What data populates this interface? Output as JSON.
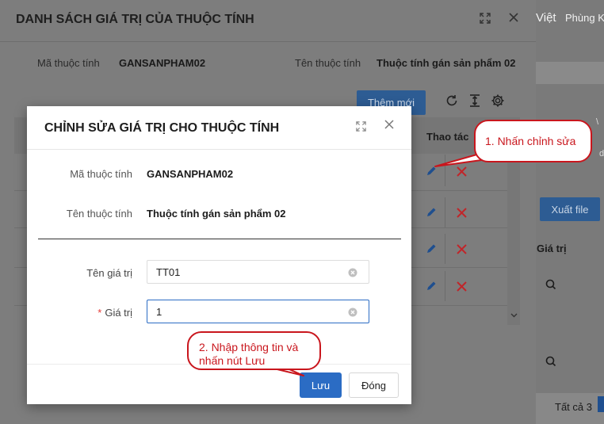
{
  "background": {
    "language": "Việt",
    "user": "Phùng K",
    "export_label": "Xuất file",
    "column_value": "Giá trị",
    "total_label": "Tất cả 3",
    "fragment_a": "\\",
    "fragment_b": "ding"
  },
  "list_dialog": {
    "title": "DANH SÁCH GIÁ TRỊ CỦA THUỘC TÍNH",
    "attr_code_label": "Mã thuộc tính",
    "attr_code_value": "GANSANPHAM02",
    "attr_name_label": "Tên thuộc tính",
    "attr_name_value": "Thuộc tính gán sản phẩm 02",
    "add_label": "Thêm mới",
    "actions_column": "Thao tác"
  },
  "edit_dialog": {
    "title": "CHỈNH SỬA GIÁ TRỊ CHO THUỘC TÍNH",
    "attr_code_label": "Mã thuộc tính",
    "attr_code_value": "GANSANPHAM02",
    "attr_name_label": "Tên thuộc tính",
    "attr_name_value": "Thuộc tính gán sản phẩm 02",
    "value_name_label": "Tên giá trị",
    "value_name_input": "TT01",
    "value_label": "Giá trị",
    "required_mark": "*",
    "value_input": "1",
    "save_label": "Lưu",
    "cancel_label": "Đóng"
  },
  "annotations": {
    "step1": "1. Nhấn chỉnh sửa",
    "step2_line1": "2. Nhập thông tin và",
    "step2_line2": "nhấn nút Lưu"
  },
  "colors": {
    "primary": "#2b6cc4",
    "annotation": "#c9161d",
    "delete": "#e53935"
  }
}
